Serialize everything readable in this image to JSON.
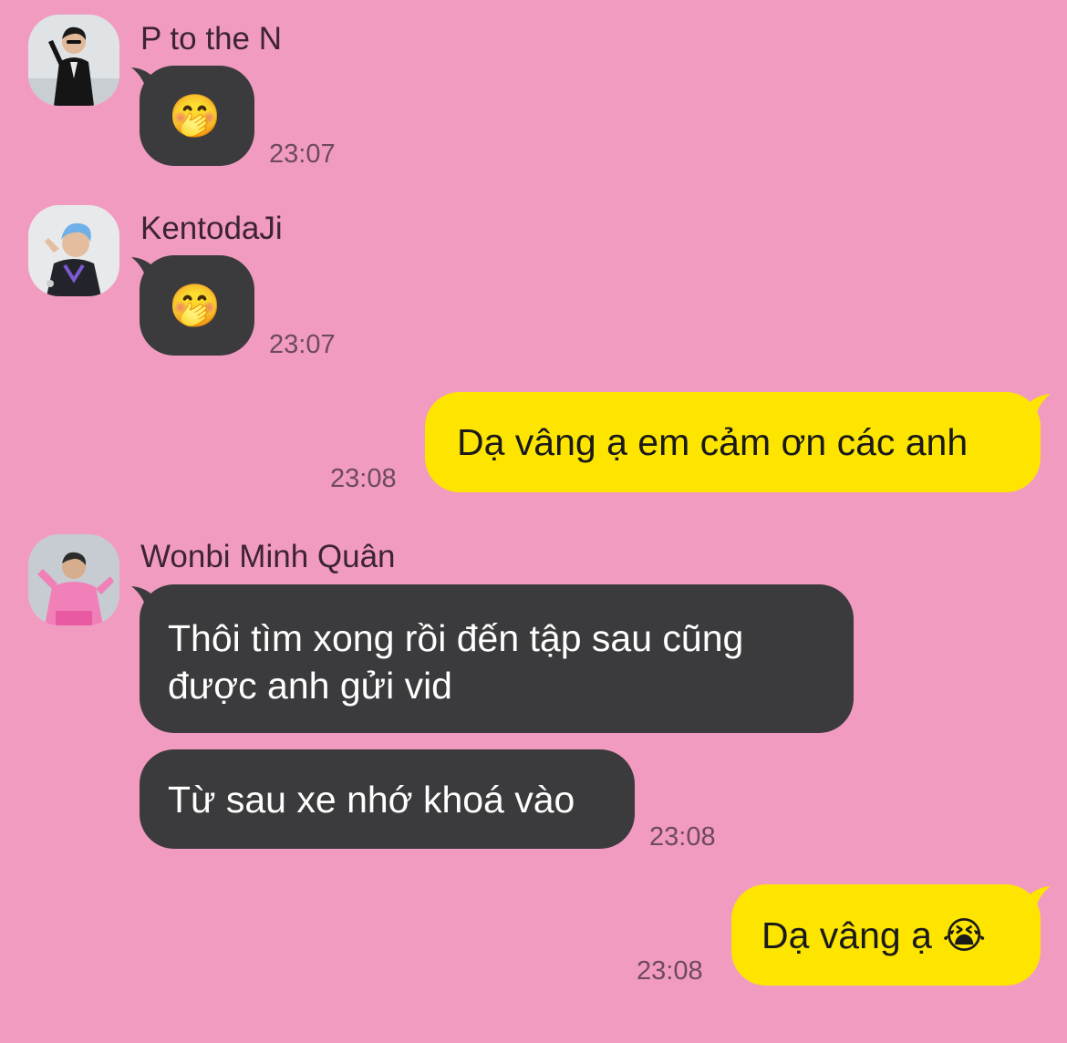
{
  "messages": [
    {
      "sender": "P to the N",
      "avatar_icon": "user-avatar-icon",
      "text": "🤭",
      "time": "23:07"
    },
    {
      "sender": "KentodaJi",
      "avatar_icon": "user-avatar-icon",
      "text": "🤭",
      "time": "23:07"
    },
    {
      "text": "Dạ vâng ạ em cảm ơn các anh",
      "time": "23:08"
    },
    {
      "sender": "Wonbi Minh Quân",
      "avatar_icon": "user-avatar-icon",
      "text_lines": [
        "Thôi tìm xong rồi đến tập sau cũng",
        "được anh gửi vid"
      ],
      "text2": "Từ sau xe nhớ khoá vào",
      "time": "23:08"
    },
    {
      "text": "Dạ vâng ạ 😭",
      "time": "23:08"
    }
  ],
  "colors": {
    "background": "#f29bc1",
    "incoming_bubble": "#3b3b3d",
    "outgoing_bubble": "#fee500"
  }
}
